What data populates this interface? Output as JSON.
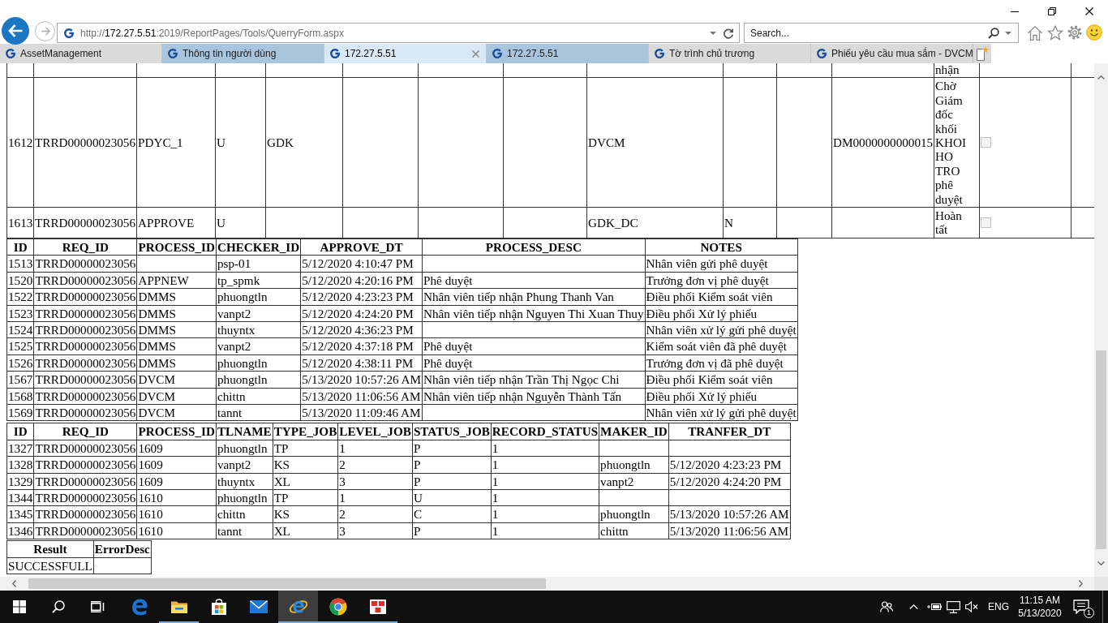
{
  "navigation": {
    "back": {
      "disabled": false
    },
    "forward": {
      "disabled": true
    }
  },
  "address_bar": {
    "url": {
      "scheme": "http://",
      "host": "172.27.5.51",
      "path": ":2019/ReportPages/Tools/QuerryForm.aspx"
    }
  },
  "search": {
    "placeholder": "Search..."
  },
  "tabs": [
    {
      "label": "AssetManagement",
      "selected": false,
      "color": "#dadada"
    },
    {
      "label": "Thông tin người dùng",
      "selected": false,
      "color": "#a9c5de"
    },
    {
      "label": "172.27.5.51",
      "selected": true,
      "color": "#d9e9f7"
    },
    {
      "label": "172.27.5.51",
      "selected": false,
      "color": "#a9c5de"
    },
    {
      "label": "Tờ trình chủ trương",
      "selected": false,
      "color": "#dadada"
    },
    {
      "label": "Phiếu yêu cầu mua sắm - DVCM",
      "selected": false,
      "color": "#dadada"
    }
  ],
  "record_table": {
    "rows": [
      {
        "cells": {
          "column_13": "nhận"
        }
      },
      {
        "cells": {
          "column_1": "1612",
          "column_2": "TRRD00000023056",
          "column_3": "PDYC_1",
          "column_4": "U",
          "column_5": "GDK",
          "column_9": "DVCM",
          "column_12": "DM0000000000015",
          "column_13": "Chờ Giám đốc khối KHOI HO TRO phê duyệt"
        },
        "checkbox": {
          "checked": false,
          "disabled": true
        }
      },
      {
        "cells": {
          "column_1": "1613",
          "column_2": "TRRD00000023056",
          "column_3": "APPROVE",
          "column_4": "U",
          "column_9": "GDK_DC",
          "column_10": "N",
          "column_13": "Hoàn tất"
        },
        "checkbox": {
          "checked": false,
          "disabled": true
        }
      }
    ]
  },
  "process_table": {
    "columns": [
      "ID",
      "REQ_ID",
      "PROCESS_ID",
      "CHECKER_ID",
      "APPROVE_DT",
      "PROCESS_DESC",
      "NOTES"
    ],
    "rows": [
      {
        "id": "1513",
        "req_id": "TRRD00000023056",
        "checker_id": "psp-01",
        "approve_dt": "5/12/2020 4:10:47 PM",
        "notes": "Nhân viên gửi phê duyệt"
      },
      {
        "id": "1520",
        "req_id": "TRRD00000023056",
        "process_id": "APPNEW",
        "checker_id": "tp_spmk",
        "approve_dt": "5/12/2020 4:20:16 PM",
        "process_desc": "Phê duyệt",
        "notes": "Trưởng đơn vị phê duyệt"
      },
      {
        "id": "1522",
        "req_id": "TRRD00000023056",
        "process_id": "DMMS",
        "checker_id": "phuongtln",
        "approve_dt": "5/12/2020 4:23:23 PM",
        "process_desc": "Nhân viên tiếp nhận Phung Thanh Van",
        "notes": "Điều phối Kiểm soát viên"
      },
      {
        "id": "1523",
        "req_id": "TRRD00000023056",
        "process_id": "DMMS",
        "checker_id": "vanpt2",
        "approve_dt": "5/12/2020 4:24:20 PM",
        "process_desc": "Nhân viên tiếp nhận Nguyen Thi Xuan Thuy",
        "notes": "Điều phối Xử lý phiếu"
      },
      {
        "id": "1524",
        "req_id": "TRRD00000023056",
        "process_id": "DMMS",
        "checker_id": "thuyntx",
        "approve_dt": "5/12/2020 4:36:23 PM",
        "notes": "Nhân viên xử lý gửi phê duyệt"
      },
      {
        "id": "1525",
        "req_id": "TRRD00000023056",
        "process_id": "DMMS",
        "checker_id": "vanpt2",
        "approve_dt": "5/12/2020 4:37:18 PM",
        "process_desc": "Phê duyệt",
        "notes": "Kiểm soát viên đã phê duyệt"
      },
      {
        "id": "1526",
        "req_id": "TRRD00000023056",
        "process_id": "DMMS",
        "checker_id": "phuongtln",
        "approve_dt": "5/12/2020 4:38:11 PM",
        "process_desc": "Phê duyệt",
        "notes": "Trưởng đơn vị đã phê duyệt"
      },
      {
        "id": "1567",
        "req_id": "TRRD00000023056",
        "process_id": "DVCM",
        "checker_id": "phuongtln",
        "approve_dt": "5/13/2020 10:57:26 AM",
        "process_desc": "Nhân viên tiếp nhận Trần Thị Ngọc Chi",
        "notes": "Điều phối Kiểm soát viên"
      },
      {
        "id": "1568",
        "req_id": "TRRD00000023056",
        "process_id": "DVCM",
        "checker_id": "chittn",
        "approve_dt": "5/13/2020 11:06:56 AM",
        "process_desc": "Nhân viên tiếp nhận Nguyễn Thành Tấn",
        "notes": "Điều phối Xử lý phiếu"
      },
      {
        "id": "1569",
        "req_id": "TRRD00000023056",
        "process_id": "DVCM",
        "checker_id": "tannt",
        "approve_dt": "5/13/2020 11:09:46 AM",
        "notes": "Nhân viên xử lý gửi phê duyệt"
      }
    ]
  },
  "job_table": {
    "columns": [
      "ID",
      "REQ_ID",
      "PROCESS_ID",
      "TLNAME",
      "TYPE_JOB",
      "LEVEL_JOB",
      "STATUS_JOB",
      "RECORD_STATUS",
      "MAKER_ID",
      "TRANFER_DT"
    ],
    "rows": [
      {
        "id": "1327",
        "req_id": "TRRD00000023056",
        "process_id": "1609",
        "tlname": "phuongtln",
        "type_job": "TP",
        "level_job": "1",
        "status_job": "P",
        "record_status": "1"
      },
      {
        "id": "1328",
        "req_id": "TRRD00000023056",
        "process_id": "1609",
        "tlname": "vanpt2",
        "type_job": "KS",
        "level_job": "2",
        "status_job": "P",
        "record_status": "1",
        "maker_id": "phuongtln",
        "tranfer_dt": "5/12/2020 4:23:23 PM"
      },
      {
        "id": "1329",
        "req_id": "TRRD00000023056",
        "process_id": "1609",
        "tlname": "thuyntx",
        "type_job": "XL",
        "level_job": "3",
        "status_job": "P",
        "record_status": "1",
        "maker_id": "vanpt2",
        "tranfer_dt": "5/12/2020 4:24:20 PM"
      },
      {
        "id": "1344",
        "req_id": "TRRD00000023056",
        "process_id": "1610",
        "tlname": "phuongtln",
        "type_job": "TP",
        "level_job": "1",
        "status_job": "U",
        "record_status": "1"
      },
      {
        "id": "1345",
        "req_id": "TRRD00000023056",
        "process_id": "1610",
        "tlname": "chittn",
        "type_job": "KS",
        "level_job": "2",
        "status_job": "C",
        "record_status": "1",
        "maker_id": "phuongtln",
        "tranfer_dt": "5/13/2020 10:57:26 AM"
      },
      {
        "id": "1346",
        "req_id": "TRRD00000023056",
        "process_id": "1610",
        "tlname": "tannt",
        "type_job": "XL",
        "level_job": "3",
        "status_job": "P",
        "record_status": "1",
        "maker_id": "chittn",
        "tranfer_dt": "5/13/2020 11:06:56 AM"
      }
    ]
  },
  "result_table": {
    "columns": [
      "Result",
      "ErrorDesc"
    ],
    "rows": [
      {
        "result": "SUCCESSFULL"
      }
    ]
  },
  "taskbar": {
    "apps": [
      {
        "kind": "edge",
        "running": false,
        "selected": false
      },
      {
        "kind": "folder",
        "running": true,
        "selected": false
      },
      {
        "kind": "store",
        "running": false,
        "selected": false
      },
      {
        "kind": "mail",
        "running": false,
        "selected": false
      },
      {
        "kind": "ie",
        "running": true,
        "selected": true
      },
      {
        "kind": "chrome",
        "running": true,
        "selected": false
      },
      {
        "kind": "tool",
        "running": true,
        "selected": false
      }
    ],
    "tray": {
      "volume_muted": true,
      "language": "ENG",
      "time": "11:15 AM",
      "date": "5/13/2020",
      "notifications": "1"
    }
  }
}
